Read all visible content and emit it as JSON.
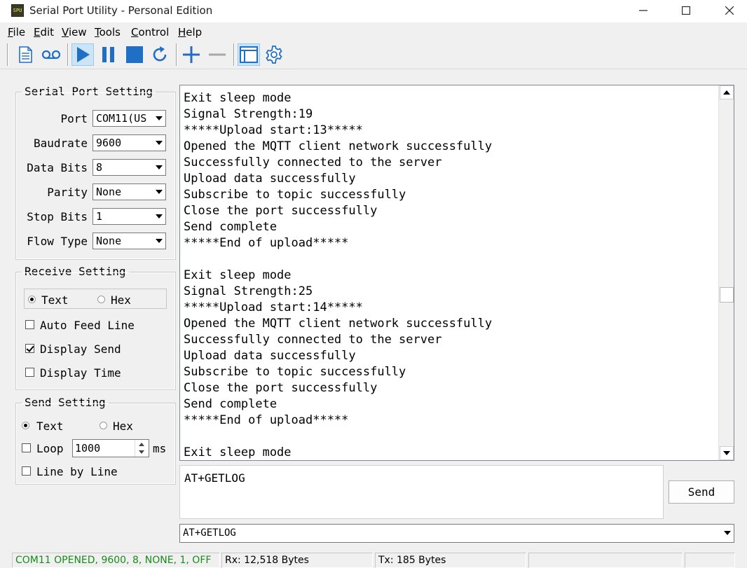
{
  "window": {
    "title": "Serial Port Utility - Personal Edition",
    "app_icon_text": "SPU"
  },
  "menu": [
    {
      "label": "File",
      "mnemonic": "F"
    },
    {
      "label": "Edit",
      "mnemonic": "E"
    },
    {
      "label": "View",
      "mnemonic": "V"
    },
    {
      "label": "Tools",
      "mnemonic": "T"
    },
    {
      "label": "Control",
      "mnemonic": "C"
    },
    {
      "label": "Help",
      "mnemonic": "H"
    }
  ],
  "toolbar": {
    "icons": [
      "new-document-icon",
      "record-icon",
      "play-icon",
      "pause-icon",
      "stop-icon",
      "refresh-icon",
      "add-icon",
      "remove-icon",
      "window-icon",
      "gear-icon"
    ],
    "accent_color": "#1f6fc5"
  },
  "serial_settings": {
    "title": "Serial Port Setting",
    "port_label": "Port",
    "port_value": "COM11(US",
    "baudrate_label": "Baudrate",
    "baudrate_value": "9600",
    "databits_label": "Data Bits",
    "databits_value": "8",
    "parity_label": "Parity",
    "parity_value": "None",
    "stopbits_label": "Stop Bits",
    "stopbits_value": "1",
    "flowtype_label": "Flow Type",
    "flowtype_value": "None"
  },
  "receive_settings": {
    "title": "Receive Setting",
    "text_label": "Text",
    "hex_label": "Hex",
    "mode": "Text",
    "auto_feed_label": "Auto Feed Line",
    "auto_feed_checked": false,
    "display_send_label": "Display Send",
    "display_send_checked": true,
    "display_time_label": "Display Time",
    "display_time_checked": false
  },
  "send_settings": {
    "title": "Send Setting",
    "text_label": "Text",
    "hex_label": "Hex",
    "mode": "Text",
    "loop_label": "Loop",
    "loop_checked": false,
    "loop_interval": "1000",
    "loop_unit": "ms",
    "line_by_line_label": "Line by Line",
    "line_by_line_checked": false
  },
  "receive_output": {
    "lines": [
      "Exit sleep mode",
      "Signal Strength:19",
      "*****Upload start:13*****",
      "Opened the MQTT client network successfully",
      "Successfully connected to the server",
      "Upload data successfully",
      "Subscribe to topic successfully",
      "Close the port successfully",
      "Send complete",
      "*****End of upload*****",
      "",
      "Exit sleep mode",
      "Signal Strength:25",
      "*****Upload start:14*****",
      "Opened the MQTT client network successfully",
      "Successfully connected to the server",
      "Upload data successfully",
      "Subscribe to topic successfully",
      "Close the port successfully",
      "Send complete",
      "*****End of upload*****",
      "",
      "Exit sleep mode"
    ]
  },
  "send": {
    "input_value": "AT+GETLOG",
    "button_label": "Send",
    "history_value": "AT+GETLOG"
  },
  "status": {
    "connection": "COM11 OPENED, 9600, 8, NONE, 1, OFF",
    "connection_color": "#1a8a1a",
    "rx": "Rx: 12,518 Bytes",
    "tx": "Tx: 185 Bytes"
  }
}
